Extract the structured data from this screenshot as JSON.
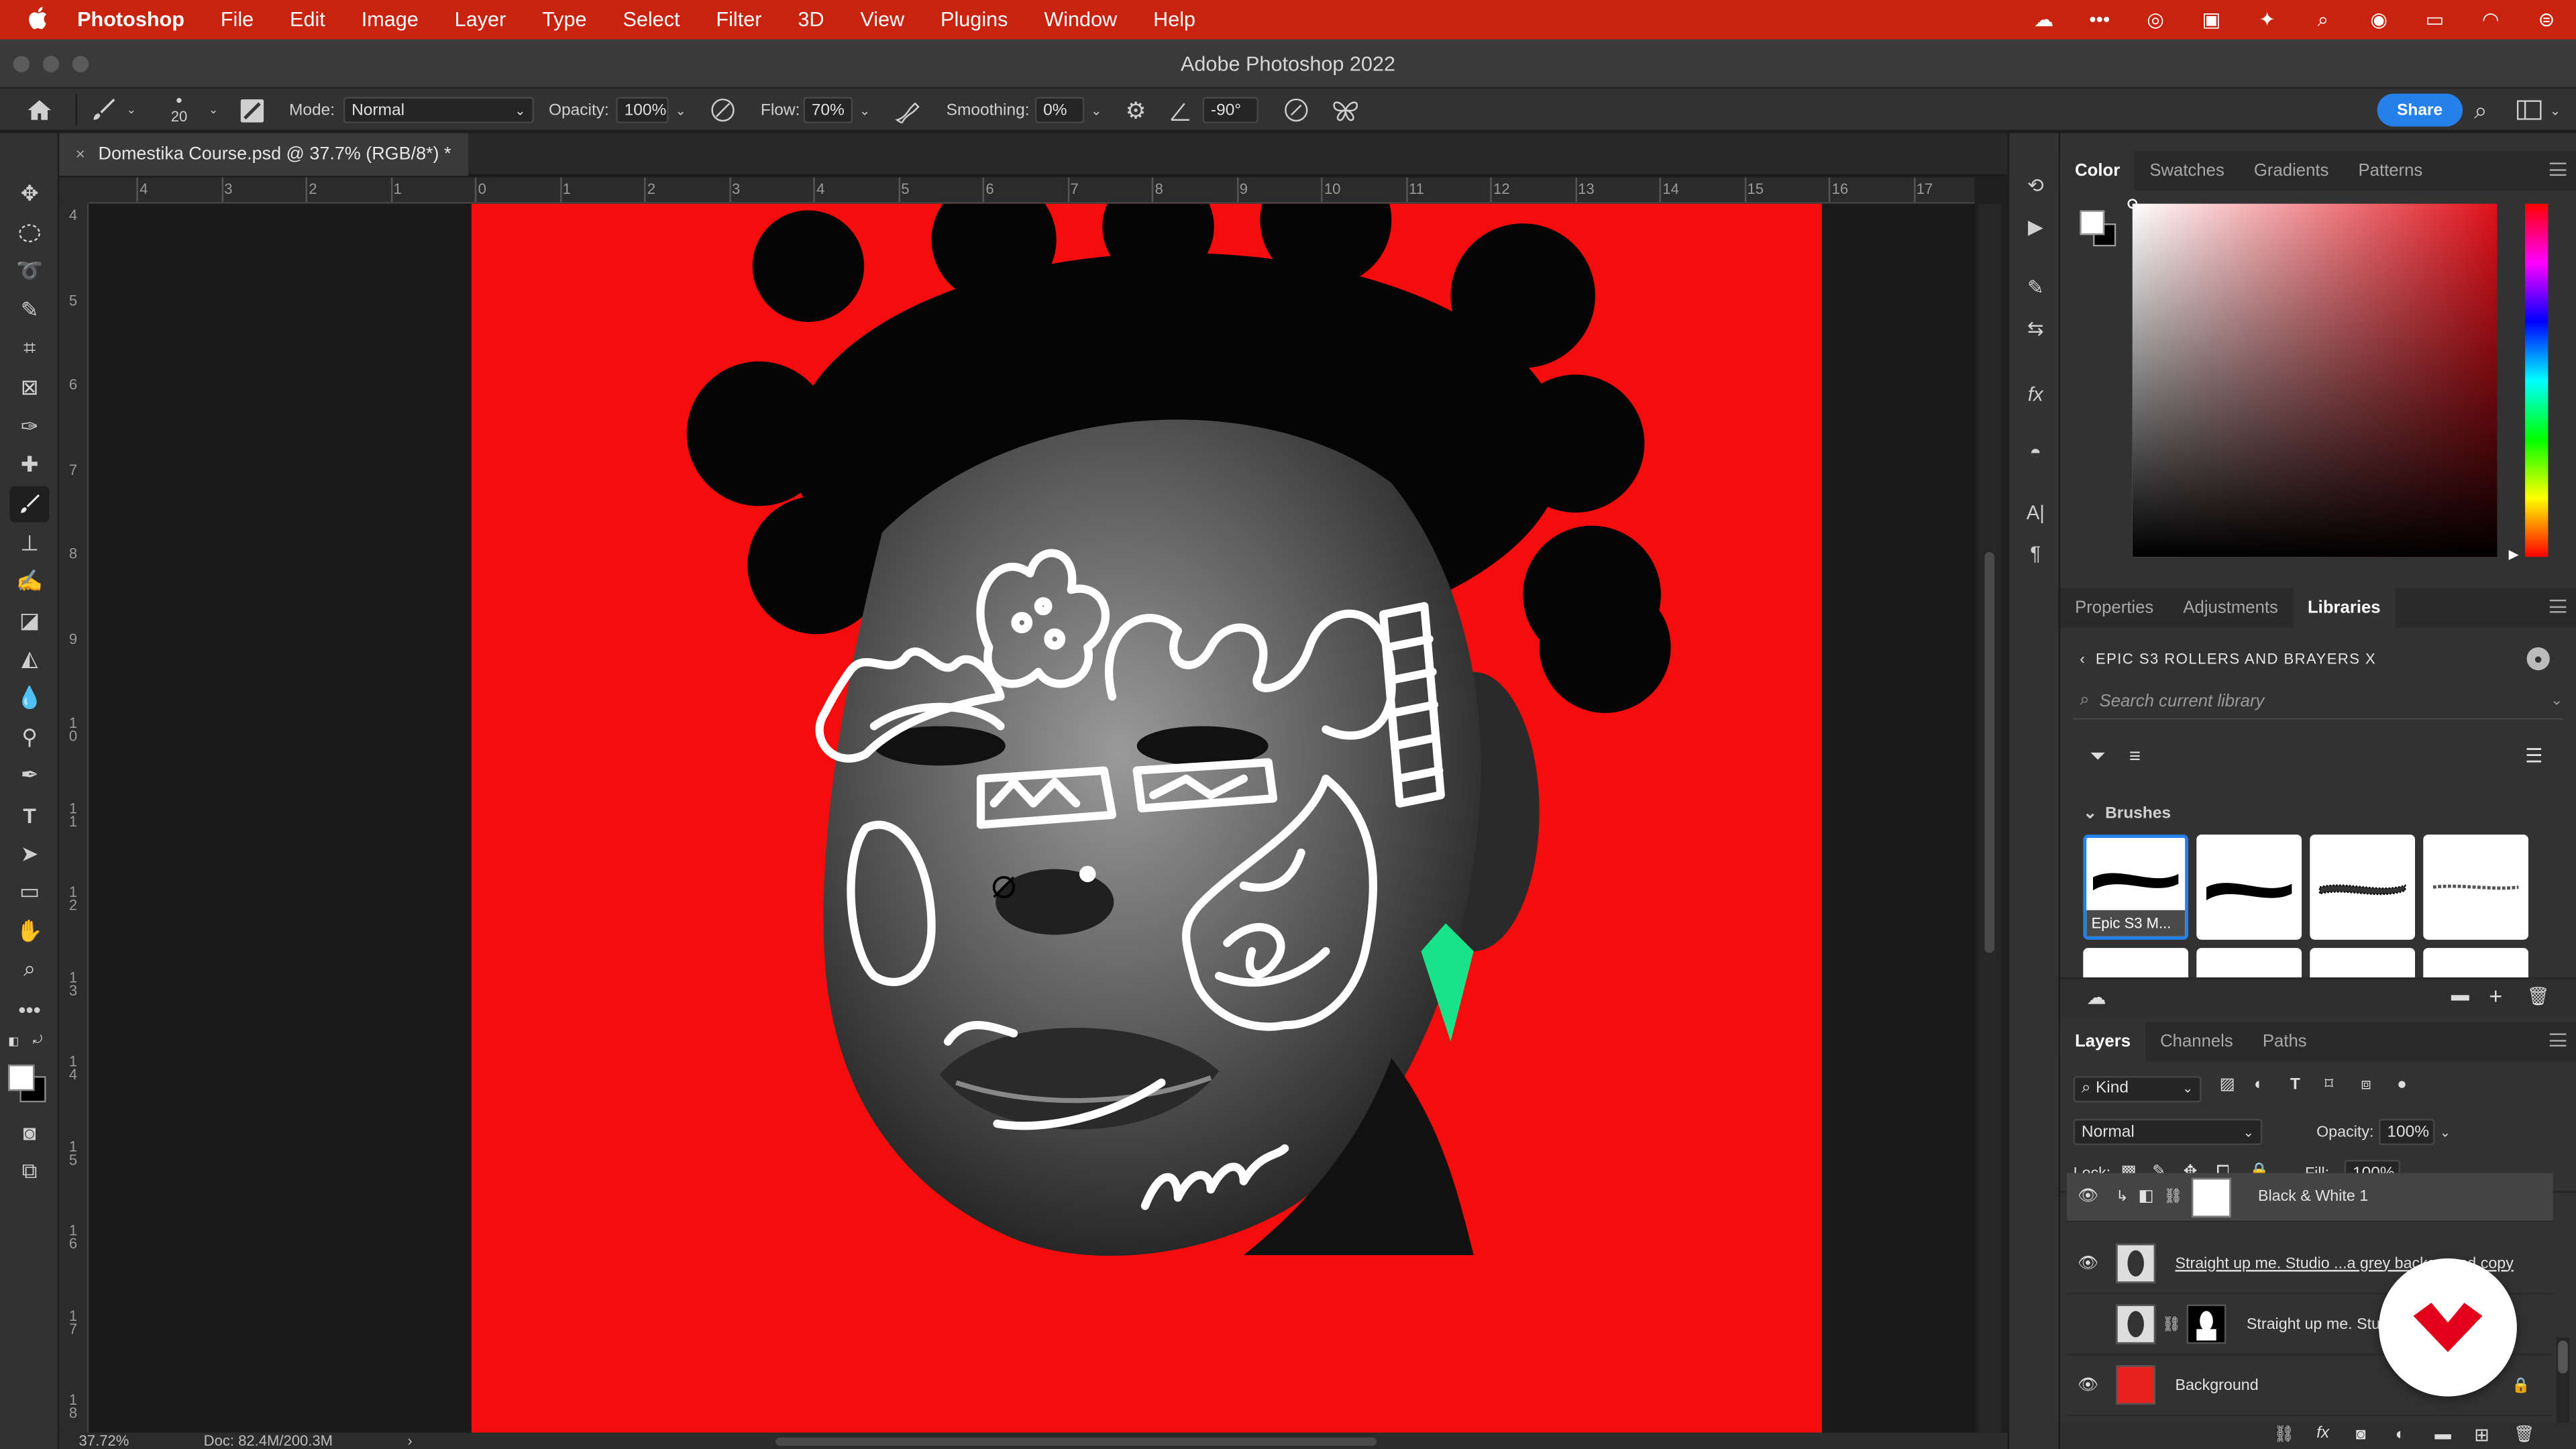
{
  "menubar": {
    "items": [
      "Photoshop",
      "File",
      "Edit",
      "Image",
      "Layer",
      "Type",
      "Select",
      "Filter",
      "3D",
      "View",
      "Plugins",
      "Window",
      "Help"
    ]
  },
  "window": {
    "title": "Adobe Photoshop 2022"
  },
  "options": {
    "brush_size": "20",
    "mode_label": "Mode:",
    "mode_value": "Normal",
    "opacity_label": "Opacity:",
    "opacity_value": "100%",
    "flow_label": "Flow:",
    "flow_value": "70%",
    "smoothing_label": "Smoothing:",
    "smoothing_value": "0%",
    "angle_value": "-90°",
    "share_label": "Share"
  },
  "document": {
    "tab_title": "Domestika Course.psd @ 37.7% (RGB/8*) *"
  },
  "ruler": {
    "h": [
      "4",
      "3",
      "2",
      "1",
      "0",
      "1",
      "2",
      "3",
      "4",
      "5",
      "6",
      "7",
      "8",
      "9",
      "10",
      "11",
      "12",
      "13",
      "14",
      "15",
      "16",
      "17"
    ],
    "v": [
      "4",
      "5",
      "6",
      "7",
      "8",
      "9",
      "10",
      "11",
      "12",
      "13",
      "14",
      "15",
      "16",
      "17",
      "18"
    ]
  },
  "status": {
    "zoom": "37.72%",
    "doc": "Doc: 82.4M/200.3M"
  },
  "color_panel": {
    "tabs": [
      "Color",
      "Swatches",
      "Gradients",
      "Patterns"
    ]
  },
  "libraries_panel": {
    "tabs": [
      "Properties",
      "Adjustments",
      "Libraries"
    ],
    "library_name": "EPIC S3 ROLLERS AND BRAYERS X",
    "search_placeholder": "Search current library",
    "section": "Brushes",
    "first_brush": "Epic S3 M..."
  },
  "layers_panel": {
    "tabs": [
      "Layers",
      "Channels",
      "Paths"
    ],
    "filter_kind": "Kind",
    "blend_mode": "Normal",
    "opacity_label": "Opacity:",
    "opacity_value": "100%",
    "lock_label": "Lock:",
    "fill_label": "Fill:",
    "fill_value": "100%",
    "layers": [
      {
        "name": "Black & White 1"
      },
      {
        "name": "Straight up me. Studio ...a grey background copy"
      },
      {
        "name": "Straight up me. Stu..."
      },
      {
        "name": "Background"
      }
    ]
  },
  "colors": {
    "accent": "#2680eb",
    "canvas_red": "#f50d0d",
    "menubar_red": "#c8230f",
    "leaf_green": "#19e38a"
  }
}
